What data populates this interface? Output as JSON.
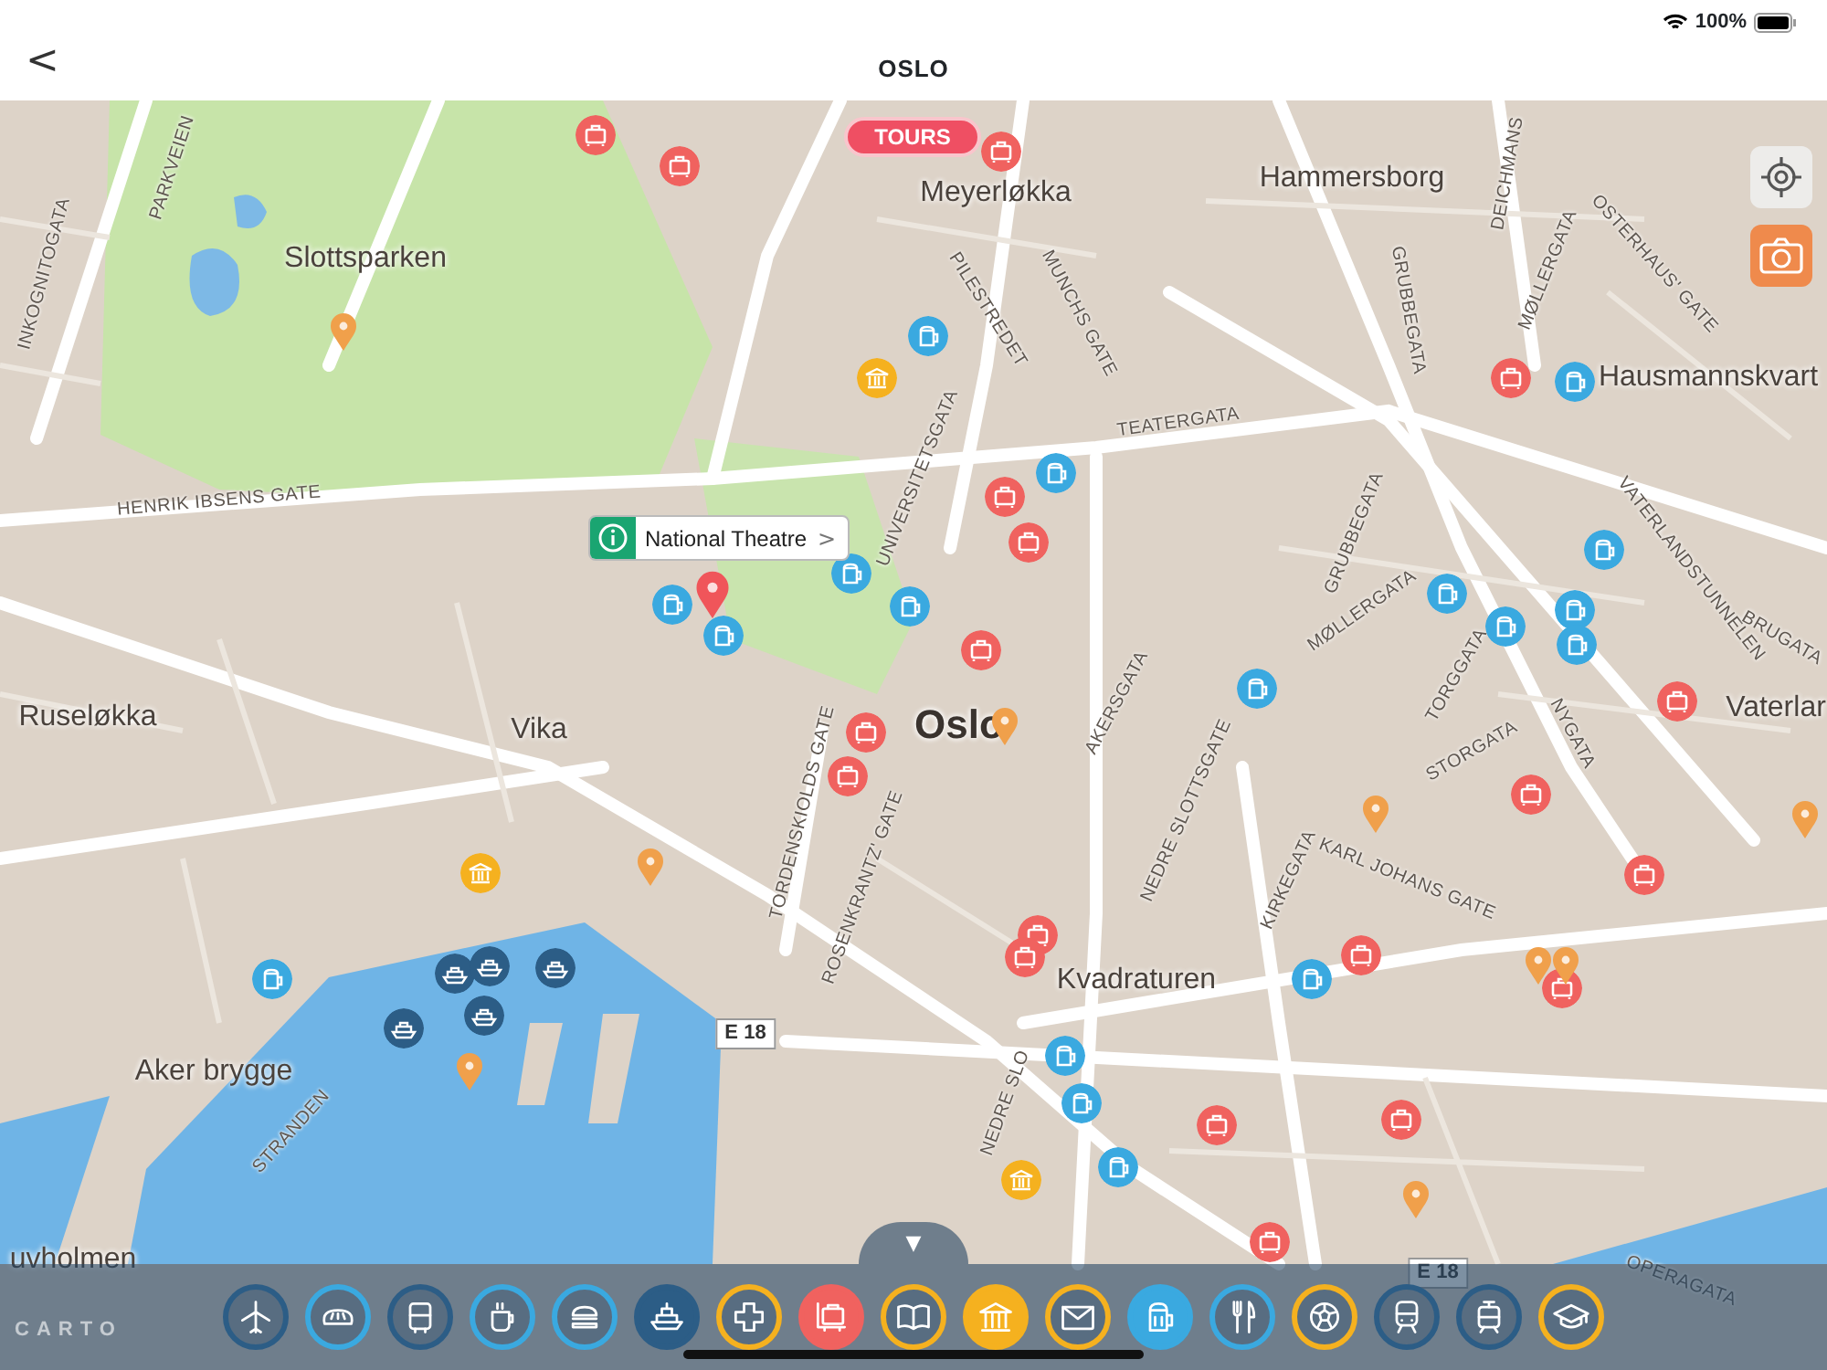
{
  "status_bar": {
    "battery": "100%"
  },
  "nav": {
    "title": "OSLO",
    "back": "<"
  },
  "tours_button": "TOURS",
  "callout": {
    "title": "National Theatre",
    "chevron": ">"
  },
  "map_labels": [
    {
      "text": "Slottsparken",
      "kind": "place"
    },
    {
      "text": "Meyerløkka",
      "kind": "place"
    },
    {
      "text": "Hammersborg",
      "kind": "place"
    },
    {
      "text": "Hausmannskvart",
      "kind": "place"
    },
    {
      "text": "HENRIK IBSENS GATE",
      "kind": "street"
    },
    {
      "text": "Ruseløkka",
      "kind": "place"
    },
    {
      "text": "Vika",
      "kind": "place"
    },
    {
      "text": "Oslo",
      "kind": "city"
    },
    {
      "text": "Kvadraturen",
      "kind": "place"
    },
    {
      "text": "Aker brygge",
      "kind": "place"
    },
    {
      "text": "uvholmen",
      "kind": "place"
    },
    {
      "text": "Vaterlar",
      "kind": "place"
    },
    {
      "text": "E 18",
      "kind": "shield"
    },
    {
      "text": "E 18",
      "kind": "shield"
    },
    {
      "text": "PARKVEIEN",
      "kind": "street"
    },
    {
      "text": "INKOGNITOGATA",
      "kind": "street"
    },
    {
      "text": "PILESTREDET",
      "kind": "street"
    },
    {
      "text": "MUNCHS GATE",
      "kind": "street"
    },
    {
      "text": "TEATERGATA",
      "kind": "street"
    },
    {
      "text": "GRUBBEGATA",
      "kind": "street"
    },
    {
      "text": "DEICHMANS",
      "kind": "street"
    },
    {
      "text": "MØLLERGATA",
      "kind": "street"
    },
    {
      "text": "OSTERHAUS' GATE",
      "kind": "street"
    },
    {
      "text": "UNIVERSITETSGATA",
      "kind": "street"
    },
    {
      "text": "VATERLANDSTUNNELEN",
      "kind": "street"
    },
    {
      "text": "BRUGATA",
      "kind": "street"
    },
    {
      "text": "GRUBBEGATA",
      "kind": "street"
    },
    {
      "text": "MØLLERGATA",
      "kind": "street"
    },
    {
      "text": "TORGGATA",
      "kind": "street"
    },
    {
      "text": "STORGATA",
      "kind": "street"
    },
    {
      "text": "NYGATA",
      "kind": "street"
    },
    {
      "text": "AKERSGATA",
      "kind": "street"
    },
    {
      "text": "NEDRE SLOTTSGATE",
      "kind": "street"
    },
    {
      "text": "TORDENSKIOLDS GATE",
      "kind": "street"
    },
    {
      "text": "ROSENKRANTZ' GATE",
      "kind": "street"
    },
    {
      "text": "KIRKEGATA",
      "kind": "street"
    },
    {
      "text": "KARL JOHANS GATE",
      "kind": "street"
    },
    {
      "text": "STRANDEN",
      "kind": "street"
    },
    {
      "text": "NEDRE SLO",
      "kind": "street"
    },
    {
      "text": "OPERAGATA",
      "kind": "street"
    }
  ],
  "drawer_handle": "▼",
  "attribution": "CARTO",
  "categories": [
    {
      "color": "#2c5d86",
      "selected": false
    },
    {
      "color": "#3aa9e0",
      "selected": false
    },
    {
      "color": "#2c5d86",
      "selected": false
    },
    {
      "color": "#3aa9e0",
      "selected": false
    },
    {
      "color": "#3aa9e0",
      "selected": false
    },
    {
      "color": "#2c5d86",
      "selected": true
    },
    {
      "color": "#f5b11f",
      "selected": false
    },
    {
      "color": "#f0625f",
      "selected": true
    },
    {
      "color": "#f5b11f",
      "selected": false
    },
    {
      "color": "#f5b11f",
      "selected": true
    },
    {
      "color": "#f5b11f",
      "selected": false
    },
    {
      "color": "#3aa9e0",
      "selected": true
    },
    {
      "color": "#3aa9e0",
      "selected": false
    },
    {
      "color": "#f5b11f",
      "selected": false
    },
    {
      "color": "#2c5d86",
      "selected": false
    },
    {
      "color": "#2c5d86",
      "selected": false
    },
    {
      "color": "#f5b11f",
      "selected": false
    }
  ]
}
